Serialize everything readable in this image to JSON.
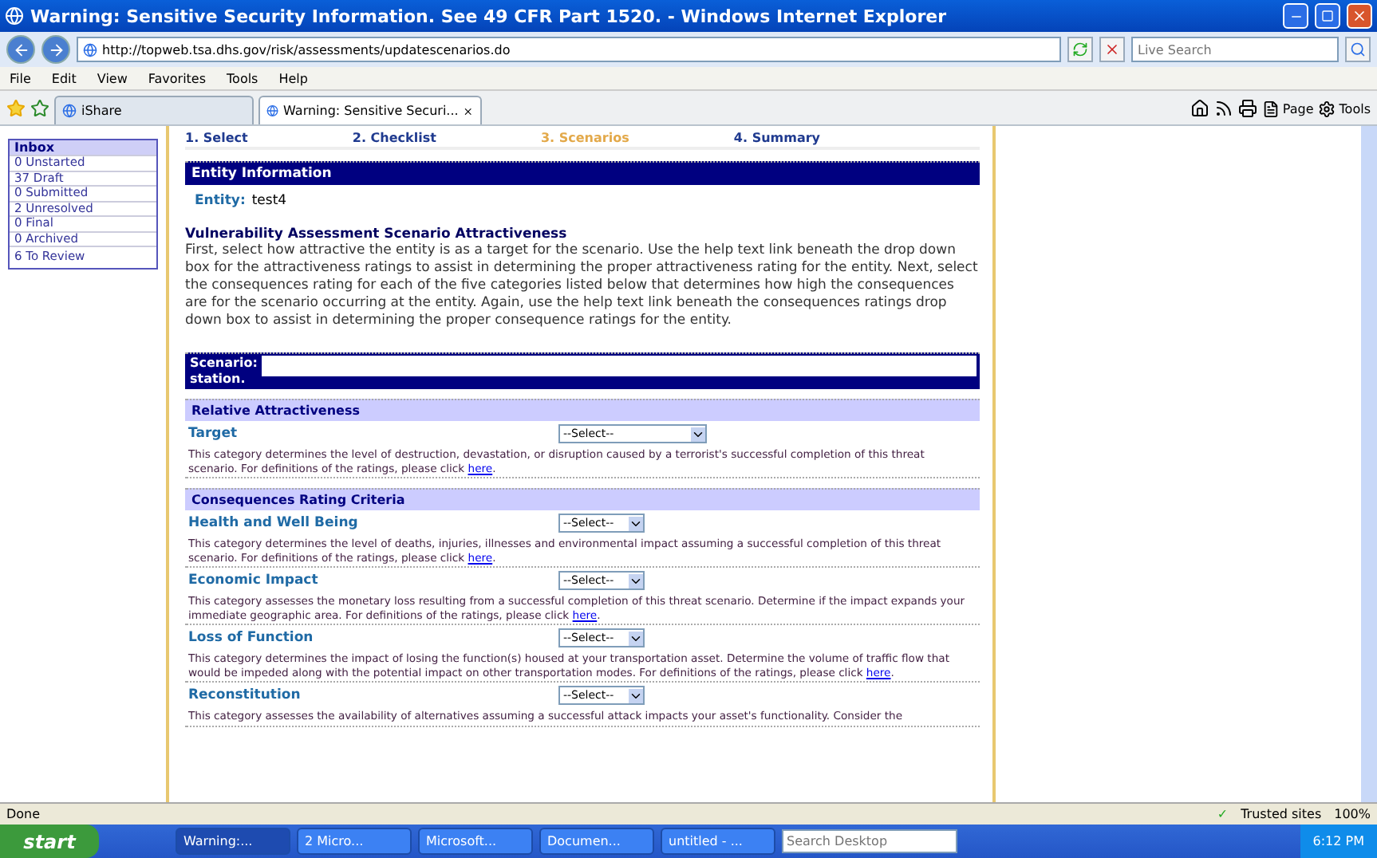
{
  "window": {
    "title": "Warning: Sensitive Security Information. See 49 CFR Part 1520. - Windows Internet Explorer"
  },
  "address": {
    "url": "http://topweb.tsa.dhs.gov/risk/assessments/updatescenarios.do",
    "search_placeholder": "Live Search"
  },
  "menu": [
    "File",
    "Edit",
    "View",
    "Favorites",
    "Tools",
    "Help"
  ],
  "tabs": [
    {
      "label": "iShare",
      "selected": false
    },
    {
      "label": "Warning: Sensitive Securi...",
      "selected": true
    }
  ],
  "commands": [
    "Page",
    "Tools"
  ],
  "inbox": {
    "title": "Inbox",
    "items": [
      "0 Unstarted",
      "37 Draft",
      "0 Submitted",
      "2 Unresolved",
      "0 Final",
      "0 Archived"
    ],
    "review": "6 To Review"
  },
  "steps": [
    {
      "label": "1. Select",
      "selected": false
    },
    {
      "label": "2. Checklist",
      "selected": false
    },
    {
      "label": "3. Scenarios",
      "selected": true
    },
    {
      "label": "4. Summary",
      "selected": false
    }
  ],
  "entity": {
    "header": "Entity Information",
    "label": "Entity:",
    "value": "test4"
  },
  "intro": {
    "heading": "Vulnerability Assessment Scenario Attractiveness",
    "text": "First, select how attractive the entity is as a target for the scenario. Use the help text link beneath the drop down box for the attractiveness ratings to assist in determining the proper attractiveness rating for the entity. Next, select the consequences rating for each of the five categories listed below that determines how high the consequences are for the scenario occurring at the entity. Again, use the help text link beneath the consequences ratings drop down box to assist in determining the proper consequence ratings for the entity."
  },
  "scenario": {
    "label": "Scenario:",
    "text": "station."
  },
  "sections": [
    {
      "title": "Relative Attractiveness",
      "categories": [
        {
          "name": "Target",
          "select": "--Select--",
          "wide": true,
          "text": "This category determines the level of destruction, devastation, or disruption caused by a terrorist's successful completion of this threat scenario. For definitions of the ratings, please click ",
          "link": "here",
          "after": "."
        }
      ]
    },
    {
      "title": "Consequences Rating Criteria",
      "categories": [
        {
          "name": "Health and Well Being",
          "select": "--Select--",
          "wide": false,
          "text": "This category determines the level of deaths, injuries, illnesses and environmental impact assuming a successful completion of this threat scenario. For definitions of the ratings, please click ",
          "link": "here",
          "after": "."
        },
        {
          "name": "Economic Impact",
          "select": "--Select--",
          "wide": false,
          "text": "This category assesses the monetary loss resulting from a successful completion of this threat scenario. Determine if the impact expands your immediate geographic area. For definitions of the ratings, please click ",
          "link": "here",
          "after": "."
        },
        {
          "name": "Loss of Function",
          "select": "--Select--",
          "wide": false,
          "text": "This category determines the impact of losing the function(s) housed at your transportation asset. Determine the volume of traffic flow that would be impeded along with the potential impact on other transportation modes. For definitions of the ratings, please click ",
          "link": "here",
          "after": "."
        },
        {
          "name": "Reconstitution",
          "select": "--Select--",
          "wide": false,
          "text": "This category assesses the availability of alternatives assuming a successful attack impacts your asset's functionality. Consider the"
        }
      ]
    }
  ],
  "status": {
    "text": "Done",
    "zone": "Trusted sites",
    "zoom": "100%",
    "zone_mark": "✓"
  },
  "taskbar": {
    "start": "start",
    "tasks": [
      "Warning:...",
      "2 Micro...",
      "Microsoft...",
      "Documen...",
      "untitled - ..."
    ],
    "search_placeholder": "Search Desktop",
    "clock": "6:12 PM"
  }
}
